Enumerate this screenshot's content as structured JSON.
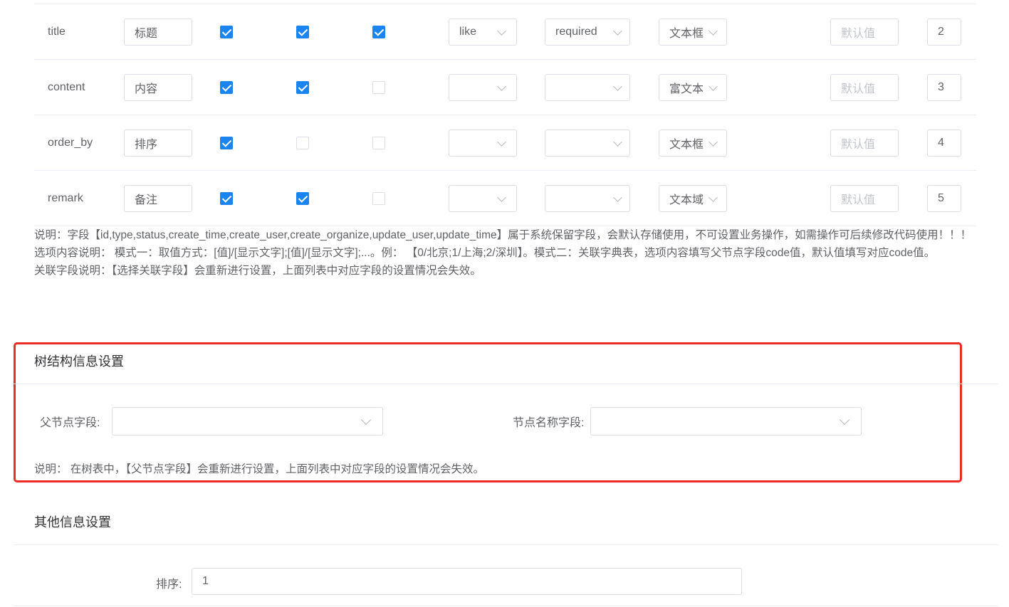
{
  "fields": [
    {
      "name": "title",
      "label": "标题",
      "check1": true,
      "check2": true,
      "check3": true,
      "query": "like",
      "rule": "required",
      "control": "文本框",
      "default_placeholder": "默认值",
      "order": "2"
    },
    {
      "name": "content",
      "label": "内容",
      "check1": true,
      "check2": true,
      "check3": false,
      "query": "",
      "rule": "",
      "control": "富文本",
      "default_placeholder": "默认值",
      "order": "3"
    },
    {
      "name": "order_by",
      "label": "排序",
      "check1": true,
      "check2": false,
      "check3": false,
      "query": "",
      "rule": "",
      "control": "文本框",
      "default_placeholder": "默认值",
      "order": "4"
    },
    {
      "name": "remark",
      "label": "备注",
      "check1": true,
      "check2": true,
      "check3": false,
      "query": "",
      "rule": "",
      "control": "文本域",
      "default_placeholder": "默认值",
      "order": "5"
    }
  ],
  "notes": {
    "line1": "说明：字段【id,type,status,create_time,create_user,create_organize,update_user,update_time】属于系统保留字段，会默认存储使用，不可设置业务操作，如需操作可后续修改代码使用！！！",
    "line2": "选项内容说明： 模式一：取值方式：[值]/[显示文字];[值]/[显示文字];...。例： 【0/北京;1/上海;2/深圳】。模式二：关联字典表，选项内容填写父节点字段code值，默认值填写对应code值。",
    "line3": "关联字段说明：【选择关联字段】会重新进行设置，上面列表中对应字段的设置情况会失效。"
  },
  "tree_section": {
    "title": "树结构信息设置",
    "parent_label": "父节点字段:",
    "parent_value": "",
    "node_label": "节点名称字段:",
    "node_value": "",
    "note": "说明： 在树表中，【父节点字段】会重新进行设置，上面列表中对应字段的设置情况会失效。"
  },
  "other_section": {
    "title": "其他信息设置",
    "sort_label": "排序:",
    "sort_value": "1"
  },
  "colors": {
    "accent": "#1a84f0",
    "highlight_border": "#ee2a24"
  }
}
